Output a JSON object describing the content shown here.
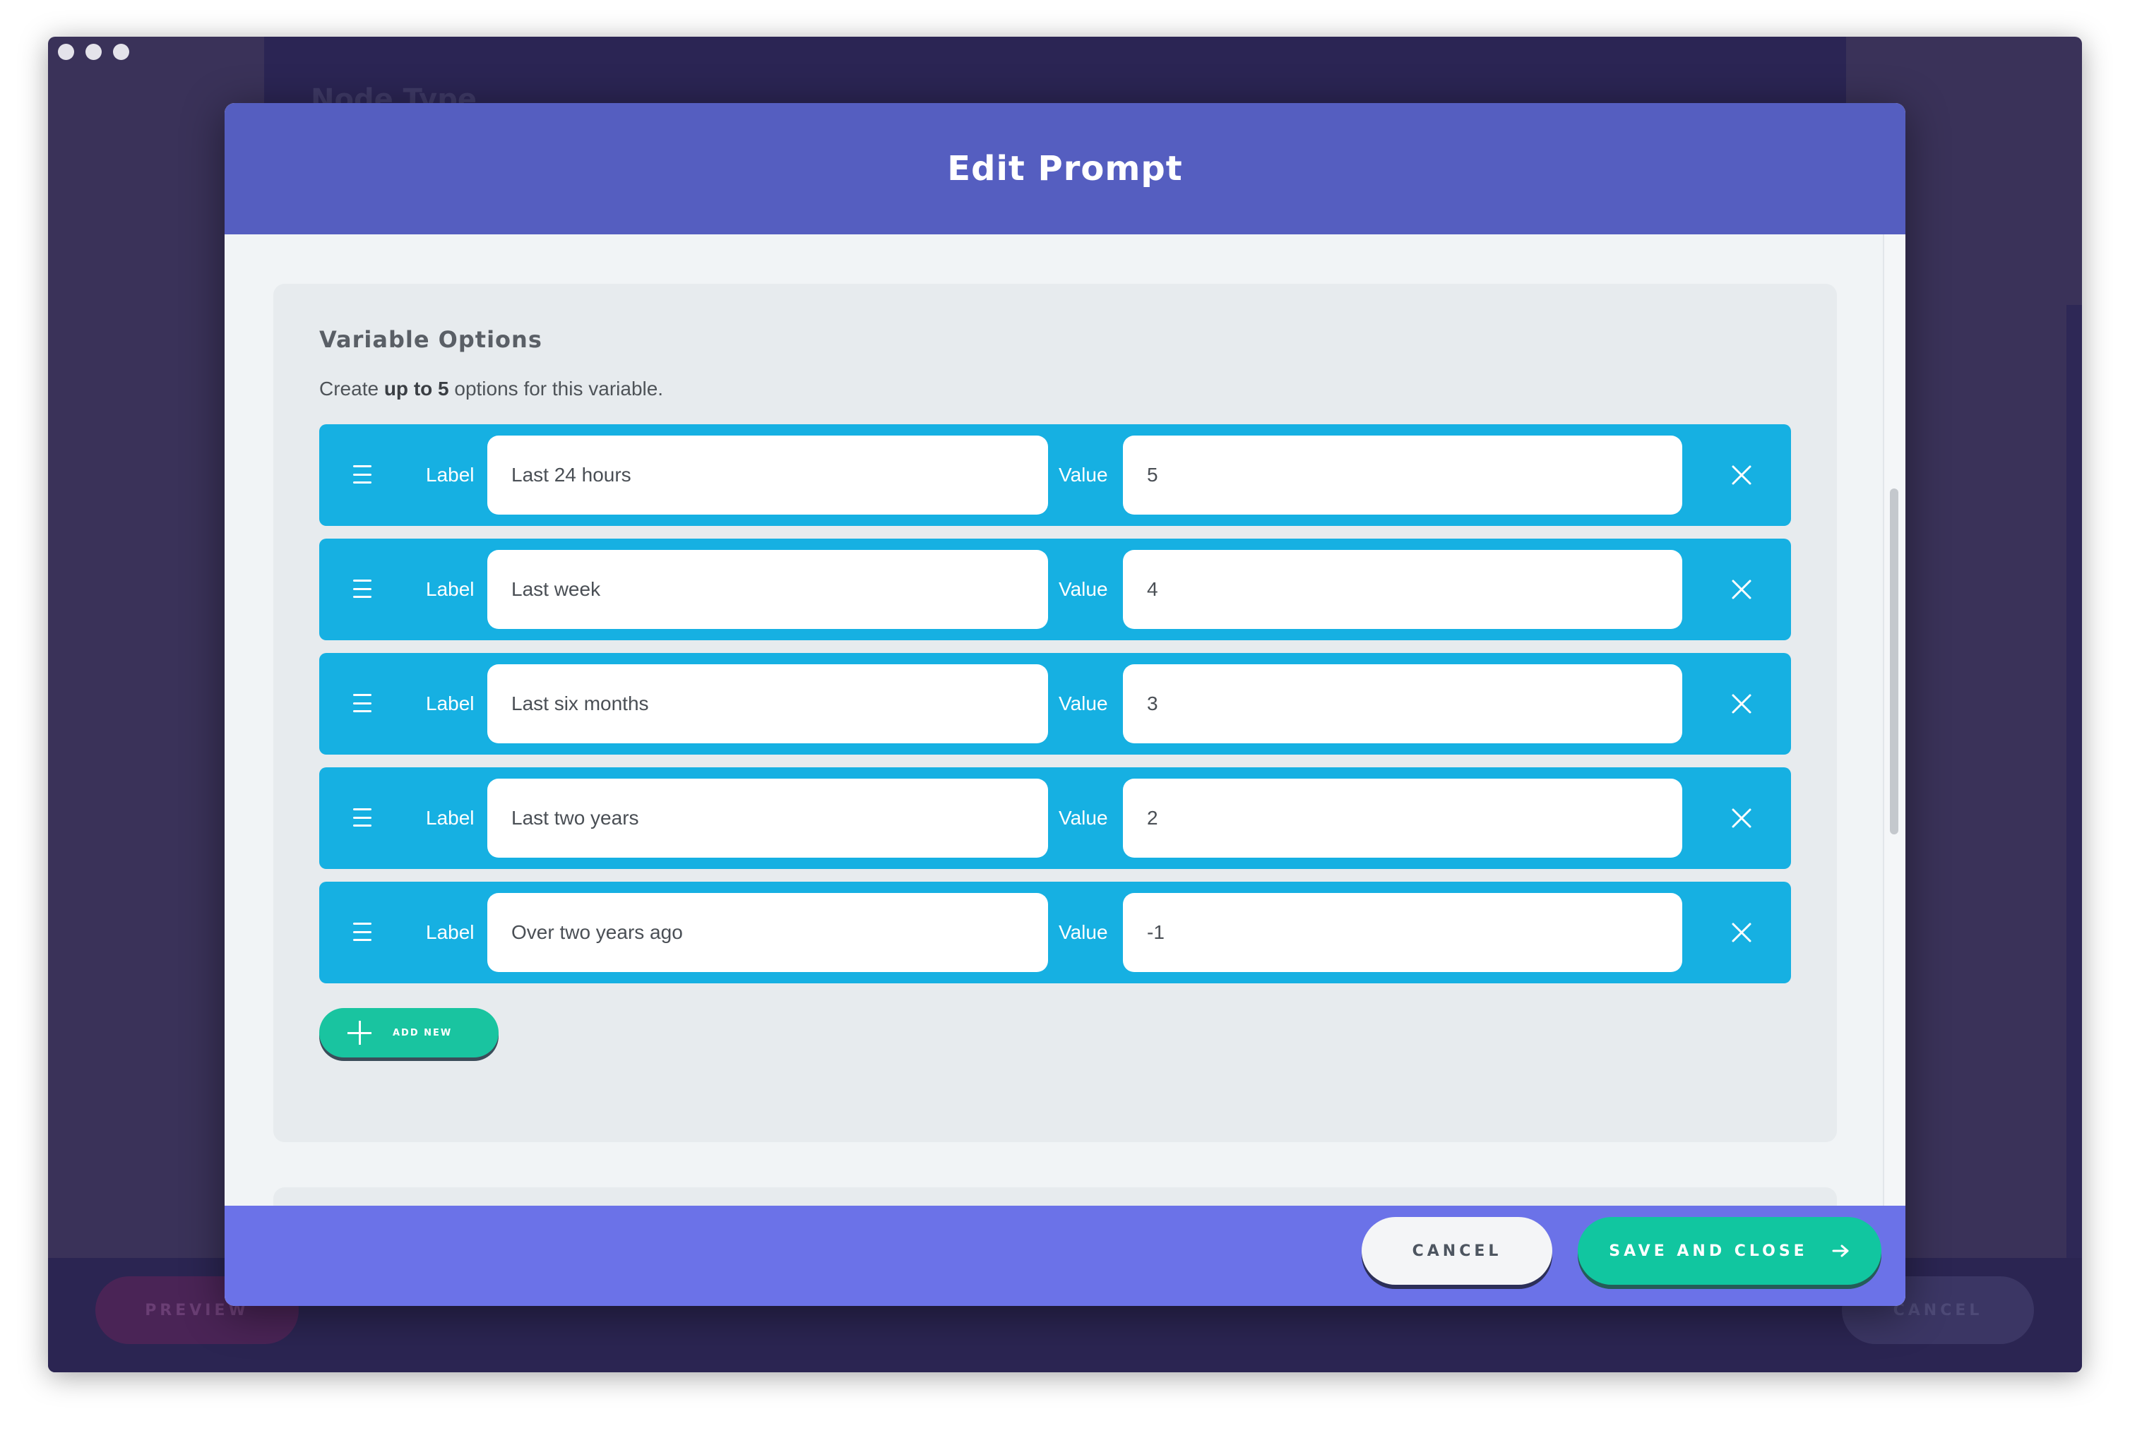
{
  "background": {
    "title": "Node Type",
    "preview_label": "PREVIEW",
    "cancel_label": "CANCEL"
  },
  "modal": {
    "title": "Edit Prompt",
    "section": {
      "title": "Variable Options",
      "desc_prefix": "Create ",
      "desc_bold": "up to 5",
      "desc_suffix": " options for this variable.",
      "label_text": "Label",
      "value_text": "Value",
      "options": [
        {
          "label": "Last 24 hours",
          "value": "5"
        },
        {
          "label": "Last week",
          "value": "4"
        },
        {
          "label": "Last six months",
          "value": "3"
        },
        {
          "label": "Last two years",
          "value": "2"
        },
        {
          "label": "Over two years ago",
          "value": "-1"
        }
      ],
      "add_new_label": "ADD NEW"
    },
    "footer": {
      "cancel_label": "CANCEL",
      "save_label": "SAVE AND CLOSE"
    }
  },
  "colors": {
    "header": "#555ec0",
    "footer": "#6b72e8",
    "row": "#16b0e2",
    "accent_green": "#11c6a0"
  }
}
